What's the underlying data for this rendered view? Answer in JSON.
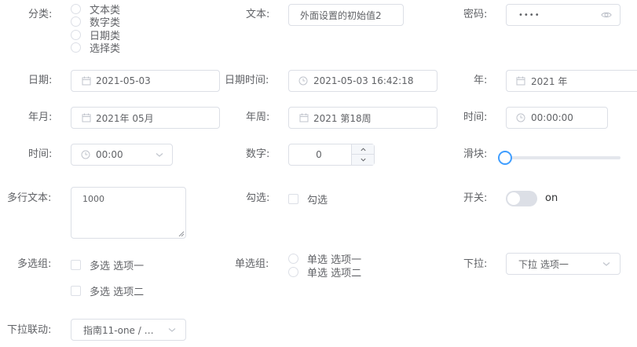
{
  "form": {
    "category": {
      "label": "分类:",
      "options": [
        "文本类",
        "数字类",
        "日期类",
        "选择类"
      ]
    },
    "text": {
      "label": "文本:",
      "value": "外面设置的初始值2"
    },
    "password": {
      "label": "密码:",
      "value": "••••"
    },
    "date": {
      "label": "日期:",
      "value": "2021-05-03"
    },
    "datetime": {
      "label": "日期时间:",
      "value": "2021-05-03 16:42:18"
    },
    "year": {
      "label": "年:",
      "value": "2021 年"
    },
    "month": {
      "label": "年月:",
      "value": "2021年 05月"
    },
    "week": {
      "label": "年周:",
      "value": "2021 第18周"
    },
    "time_picker": {
      "label": "时间:",
      "value": "00:00:00"
    },
    "time_select": {
      "label": "时间:",
      "value": "00:00"
    },
    "number": {
      "label": "数字:",
      "value": "0"
    },
    "slider": {
      "label": "滑块:",
      "value": 0
    },
    "textarea": {
      "label": "多行文本:",
      "value": "1000"
    },
    "check_single": {
      "label": "勾选:",
      "option": "勾选"
    },
    "switch": {
      "label": "开关:",
      "text": "on",
      "on": false
    },
    "checkbox_group": {
      "label": "多选组:",
      "options": [
        "多选 选项一",
        "多选 选项二"
      ]
    },
    "radio_group": {
      "label": "单选组:",
      "options": [
        "单选 选项一",
        "单选 选项二"
      ]
    },
    "dropdown": {
      "label": "下拉:",
      "value": "下拉 选项一"
    },
    "cascader": {
      "label": "下拉联动:",
      "value": "指南11-one / 设..."
    }
  },
  "icons": {
    "calendar": "calendar-icon",
    "clock": "clock-icon",
    "eye": "eye-icon",
    "chevron": "chevron-down-icon",
    "arrow_up": "arrow-up-icon",
    "arrow_down": "arrow-down-icon"
  },
  "colors": {
    "border": "#dcdfe6",
    "text": "#606266",
    "icon": "#c0c4cc",
    "accent": "#409eff",
    "switch_off": "#dcdfe6"
  }
}
